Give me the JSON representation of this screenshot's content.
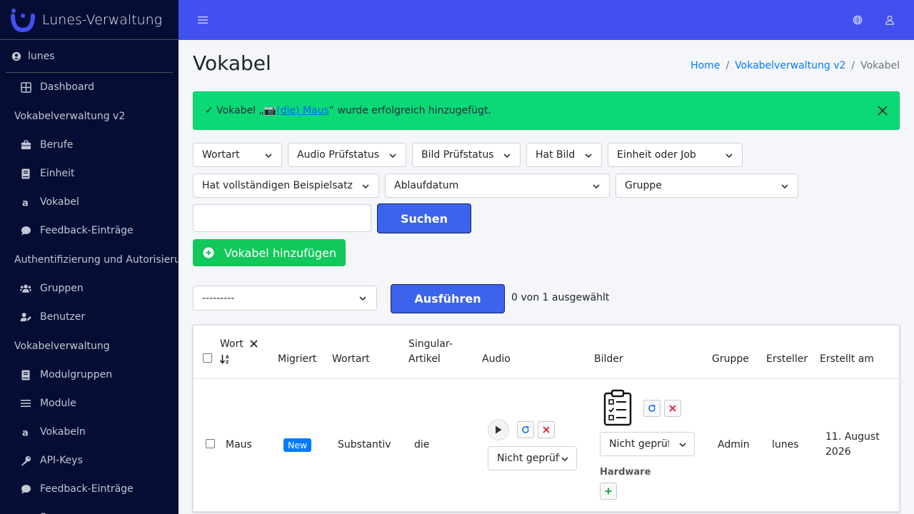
{
  "app": {
    "brand": "Lunes-Verwaltung",
    "user": "lunes"
  },
  "sidebar": {
    "items": [
      {
        "type": "item",
        "label": "Dashboard",
        "icon": "dashboard-grid-icon"
      },
      {
        "type": "header",
        "label": "Vokabelverwaltung v2"
      },
      {
        "type": "item",
        "label": "Berufe",
        "icon": "briefcase-icon"
      },
      {
        "type": "item",
        "label": "Einheit",
        "icon": "book-icon"
      },
      {
        "type": "item",
        "label": "Vokabel",
        "icon": "letter-a-icon"
      },
      {
        "type": "item",
        "label": "Feedback-Einträge",
        "icon": "comment-icon"
      },
      {
        "type": "header",
        "label": "Authentifizierung und Autorisierung"
      },
      {
        "type": "item",
        "label": "Gruppen",
        "icon": "users-icon"
      },
      {
        "type": "item",
        "label": "Benutzer",
        "icon": "user-edit-icon"
      },
      {
        "type": "header",
        "label": "Vokabelverwaltung"
      },
      {
        "type": "item",
        "label": "Modulgruppen",
        "icon": "book-icon"
      },
      {
        "type": "item",
        "label": "Module",
        "icon": "list-icon"
      },
      {
        "type": "item",
        "label": "Vokabeln",
        "icon": "letter-a-icon"
      },
      {
        "type": "item",
        "label": "API-Keys",
        "icon": "key-icon"
      },
      {
        "type": "item",
        "label": "Feedback-Einträge",
        "icon": "comment-icon"
      },
      {
        "type": "item",
        "label": "Sponsoren",
        "icon": "handshake-icon"
      }
    ]
  },
  "topbar": {
    "menu_icon": "hamburger-icon",
    "lang_icon": "globe-icon",
    "user_icon": "user-icon"
  },
  "page": {
    "title": "Vokabel",
    "breadcrumb": {
      "home": "Home",
      "section": "Vokabelverwaltung v2",
      "current": "Vokabel",
      "sep": "/"
    }
  },
  "alert": {
    "prefix": "✓ Vokabel „📷 ",
    "link": "(die) Maus",
    "suffix": "“ wurde erfolgreich hinzugefügt."
  },
  "filters": {
    "wortart": "Wortart",
    "audio": "Audio Prüfstatus",
    "bild": "Bild Prüfstatus",
    "hat_bild": "Hat Bild",
    "einheit": "Einheit oder Job",
    "beispielsatz": "Hat vollständigen Beispielsatz",
    "ablauf": "Ablaufdatum",
    "gruppe": "Gruppe"
  },
  "search": {
    "value": "",
    "button": "Suchen"
  },
  "add_button": "Vokabel hinzufügen",
  "actions": {
    "selected": "---------",
    "run": "Ausführen",
    "count": "0 von 1 ausgewählt"
  },
  "table": {
    "headers": {
      "wort": "Wort",
      "migriert": "Migriert",
      "wortart": "Wortart",
      "singular1": "Singular-",
      "singular2": "Artikel",
      "audio": "Audio",
      "bilder": "Bilder",
      "gruppe": "Gruppe",
      "ersteller": "Ersteller",
      "erstellt": "Erstellt am"
    },
    "rows": [
      {
        "wort": "Maus",
        "migriert": "New",
        "wortart": "Substantiv",
        "artikel": "die",
        "audio_status": "Nicht geprüft",
        "bild_status": "Nicht geprüft",
        "hardware_label": "Hardware",
        "gruppe": "Admin",
        "ersteller": "lunes",
        "erstellt1": "11. August",
        "erstellt2": "2026"
      }
    ]
  },
  "colors": {
    "sidebar": "#050d35",
    "topbar": "#4250ef",
    "alert": "#0bd976",
    "primary": "#3c63eb",
    "success": "#12c85b"
  }
}
